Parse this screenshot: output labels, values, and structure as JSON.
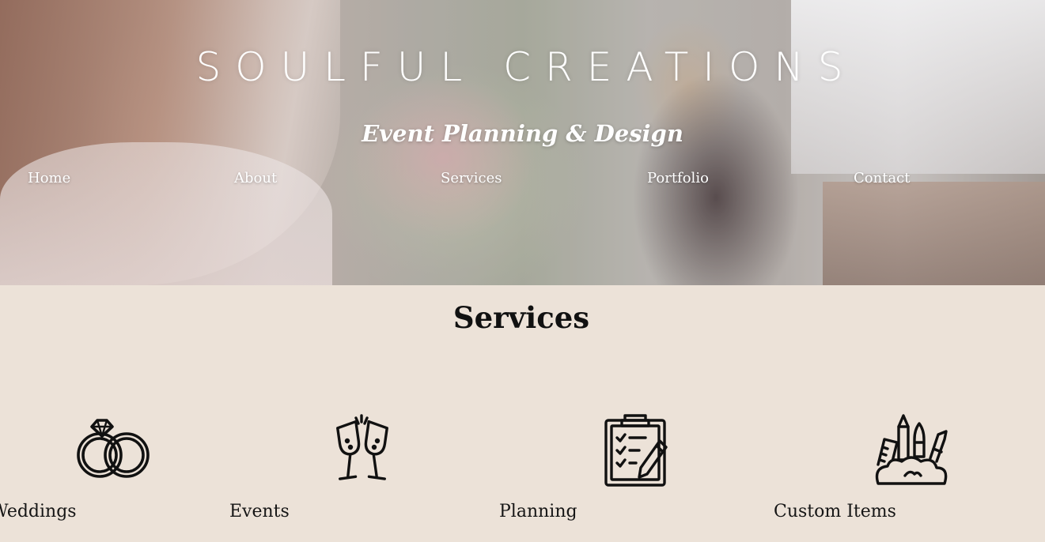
{
  "header": {
    "brand": "SOULFUL CREATIONS",
    "tagline": "Event Planning & Design"
  },
  "nav": {
    "items": [
      {
        "label": "Home"
      },
      {
        "label": "About"
      },
      {
        "label": "Services"
      },
      {
        "label": "Portfolio"
      },
      {
        "label": "Contact"
      }
    ]
  },
  "services": {
    "title": "Services",
    "items": [
      {
        "title": "Weddings",
        "icon": "wedding-rings-icon"
      },
      {
        "title": "Events",
        "icon": "champagne-toast-icon"
      },
      {
        "title": "Planning",
        "icon": "clipboard-checklist-icon"
      },
      {
        "title": "Custom Items",
        "icon": "craft-supplies-icon"
      }
    ]
  },
  "colors": {
    "background": "#ece2d8",
    "text": "#111111",
    "nav_text": "#ffffff"
  }
}
